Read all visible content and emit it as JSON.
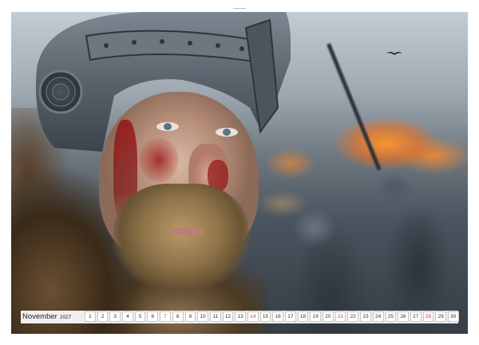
{
  "calendar": {
    "month": "November",
    "year": "2027",
    "days": [
      {
        "d": "1",
        "w": false
      },
      {
        "d": "2",
        "w": false
      },
      {
        "d": "3",
        "w": false
      },
      {
        "d": "4",
        "w": false
      },
      {
        "d": "5",
        "w": false
      },
      {
        "d": "6",
        "w": false
      },
      {
        "d": "7",
        "w": true
      },
      {
        "d": "8",
        "w": false
      },
      {
        "d": "9",
        "w": false
      },
      {
        "d": "10",
        "w": false
      },
      {
        "d": "11",
        "w": false
      },
      {
        "d": "12",
        "w": false
      },
      {
        "d": "13",
        "w": false
      },
      {
        "d": "14",
        "w": true
      },
      {
        "d": "15",
        "w": false
      },
      {
        "d": "16",
        "w": false
      },
      {
        "d": "17",
        "w": false
      },
      {
        "d": "18",
        "w": false
      },
      {
        "d": "19",
        "w": false
      },
      {
        "d": "20",
        "w": false
      },
      {
        "d": "21",
        "w": true
      },
      {
        "d": "22",
        "w": false
      },
      {
        "d": "23",
        "w": false
      },
      {
        "d": "24",
        "w": false
      },
      {
        "d": "25",
        "w": false
      },
      {
        "d": "26",
        "w": false
      },
      {
        "d": "27",
        "w": false
      },
      {
        "d": "28",
        "w": true
      },
      {
        "d": "29",
        "w": false
      },
      {
        "d": "30",
        "w": false
      }
    ]
  },
  "colors": {
    "weekend": "#d23a3a",
    "text": "#333333",
    "binding_holes": "#9aa0a8"
  },
  "photo": {
    "subject": "viking-warrior"
  }
}
